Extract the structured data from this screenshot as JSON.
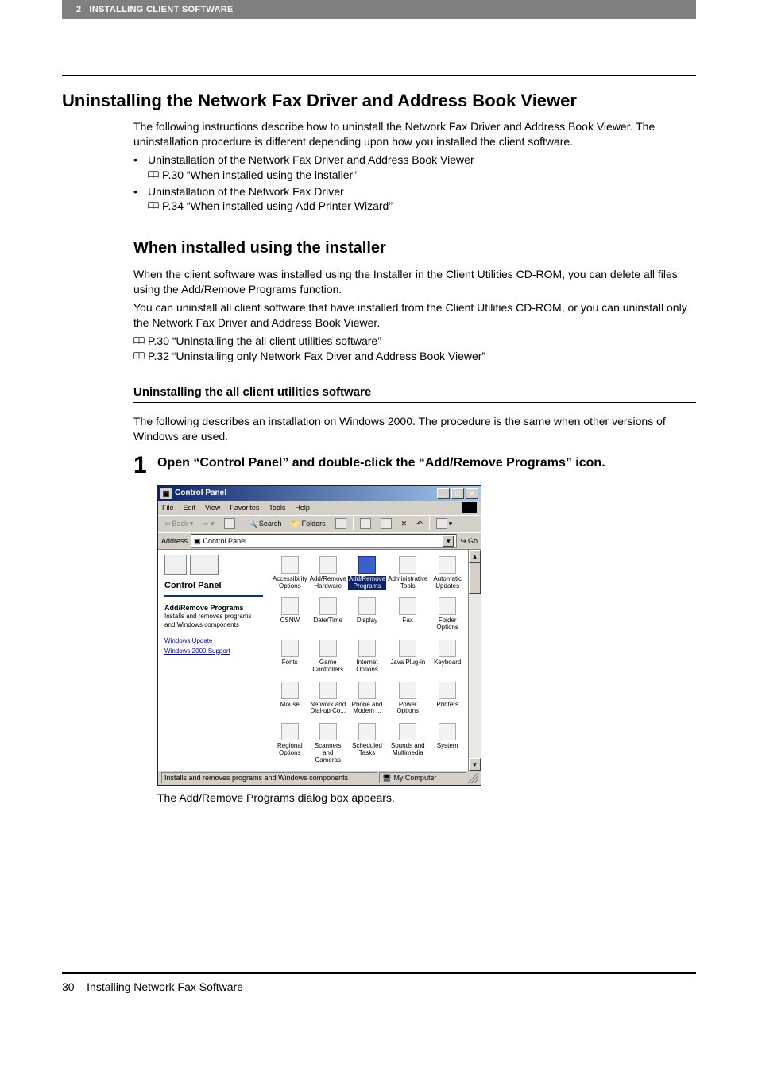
{
  "header": {
    "chapter_num": "2",
    "chapter_title": "INSTALLING CLIENT SOFTWARE"
  },
  "title": "Uninstalling the Network Fax Driver and Address Book Viewer",
  "intro": "The following instructions describe how to uninstall the Network Fax Driver and Address Book Viewer. The uninstallation procedure is different depending upon how you installed the client software.",
  "bullets": [
    {
      "text": "Uninstallation of the Network Fax Driver and Address Book Viewer",
      "ref": "P.30 “When installed using the installer”"
    },
    {
      "text": "Uninstallation of the Network Fax Driver",
      "ref": "P.34 “When installed using Add Printer Wizard”"
    }
  ],
  "sections": {
    "s1": {
      "heading": "When installed using the installer",
      "p1": "When the client software was installed using the Installer in the Client Utilities CD-ROM, you can delete all files using the Add/Remove Programs function.",
      "p2": "You can uninstall all client software that have installed from the Client Utilities CD-ROM, or you can uninstall only the Network Fax Driver and Address Book Viewer.",
      "refs": [
        "P.30 “Uninstalling the all client utilities software”",
        "P.32 “Uninstalling only Network Fax Diver and Address Book Viewer”"
      ],
      "sub": {
        "heading": "Uninstalling the all client utilities software",
        "p1": "The following describes an installation on Windows 2000. The procedure is the same when other versions of Windows are used.",
        "steps": [
          {
            "num": "1",
            "text": "Open “Control Panel” and double-click the “Add/Remove Programs” icon."
          }
        ],
        "caption": "The Add/Remove Programs dialog box appears."
      }
    }
  },
  "screenshot": {
    "title": "Control Panel",
    "menus": [
      "File",
      "Edit",
      "View",
      "Favorites",
      "Tools",
      "Help"
    ],
    "toolbar": {
      "back": "Back",
      "search": "Search",
      "folders": "Folders"
    },
    "address_label": "Address",
    "address_value": "Control Panel",
    "go_label": "Go",
    "left": {
      "title": "Control Panel",
      "arp_title": "Add/Remove Programs",
      "arp_desc": "Installs and removes programs and Windows components",
      "links": [
        "Windows Update",
        "Windows 2000 Support"
      ]
    },
    "items": [
      "Accessibility Options",
      "Add/Remove Hardware",
      "Add/Remove Programs",
      "Administrative Tools",
      "Automatic Updates",
      "CSNW",
      "Date/Time",
      "Display",
      "Fax",
      "Folder Options",
      "Fonts",
      "Game Controllers",
      "Internet Options",
      "Java Plug-in",
      "Keyboard",
      "Mouse",
      "Network and Dial-up Co...",
      "Phone and Modem ...",
      "Power Options",
      "Printers",
      "Regional Options",
      "Scanners and Cameras",
      "Scheduled Tasks",
      "Sounds and Multimedia",
      "System"
    ],
    "selected_index": 2,
    "status_left": "Installs and removes programs and Windows components",
    "status_right": "My Computer"
  },
  "footer": {
    "page_num": "30",
    "footer_text": "Installing Network Fax Software"
  }
}
